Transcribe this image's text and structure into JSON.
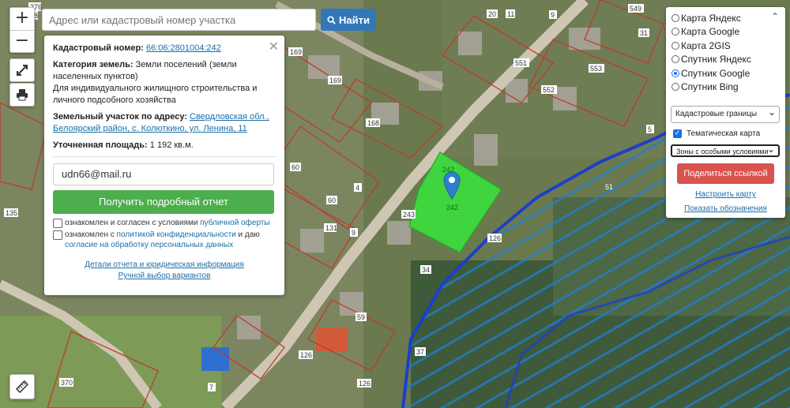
{
  "search": {
    "placeholder": "Адрес или кадастровый номер участка",
    "button": "Найти"
  },
  "zoom": {
    "in": "+",
    "out": "−"
  },
  "icons": {
    "fullscreen": "fullscreen-icon",
    "print": "print-icon",
    "ruler": "ruler-icon",
    "search": "search-icon",
    "close": "close-icon",
    "marker": "map-marker-icon"
  },
  "popup": {
    "cad_label": "Кадастровый номер:",
    "cad_value": "66:06:2801004:242",
    "cat_label": "Категория земель:",
    "cat_value": "Земли поселений (земли населенных пунктов)",
    "usage": "Для индивидуального жилищного строительства и личного подсобного хозяйства",
    "addr_label": "Земельный участок по адресу:",
    "addr_value": "Свердловская обл., Белоярский район, с. Колюткино, ул. Ленина, 11",
    "area_label": "Уточненная площадь:",
    "area_value": "1 192 кв.м.",
    "email": "udn66@mail.ru",
    "report_button": "Получить подробный отчет",
    "agree1_text": "ознакомлен и согласен с условиями",
    "agree1_link": "публичной оферты",
    "agree2_text": "ознакомлен с",
    "agree2_link": "политикой конфиденциальности",
    "agree2_mid": "и даю",
    "agree2_link2": "согласие на обработку персональных данных",
    "details_link": "Детали отчета и юридическая информация",
    "manual_link": "Ручной выбор вариантов"
  },
  "layers": {
    "base": [
      "Карта Яндекс",
      "Карта Google",
      "Карта 2GIS",
      "Спутник Яндекс",
      "Спутник Google",
      "Спутник Bing"
    ],
    "selected_base": "Спутник Google",
    "select1": "Кадастровые границы",
    "thematic_label": "Тематическая карта",
    "select2": "Зоны с особыми условиями",
    "share_button": "Поделиться ссылкой",
    "configure_link": "Настроить карту",
    "legend_link": "Показать обозначения"
  },
  "map_labels": [
    "276",
    "18",
    "169",
    "169",
    "168",
    "60",
    "4",
    "60",
    "135",
    "131",
    "243",
    "242",
    "242",
    "126",
    "9",
    "9",
    "34",
    "59",
    "37",
    "126",
    "126",
    "370",
    "7",
    "11",
    "20",
    "31",
    "553",
    "552",
    "551",
    "549",
    "5",
    "51"
  ],
  "colors": {
    "parcel": "#3ddc3d",
    "zone": "#1a6ea8",
    "boundary": "#c0392b",
    "road": "#cfc6b4"
  }
}
